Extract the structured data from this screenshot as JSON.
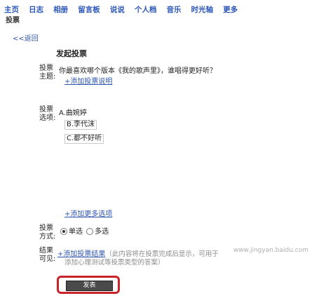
{
  "nav": {
    "items": [
      "主页",
      "日志",
      "相册",
      "留言板",
      "说说",
      "个人档",
      "音乐",
      "时光轴",
      "更多"
    ]
  },
  "subnav": {
    "label": "投票"
  },
  "back": {
    "label": "<<返回"
  },
  "form": {
    "heading": "发起投票",
    "subject_label": "投票主题:",
    "subject_value": "你最喜欢哪个版本《我的歌声里》，谁唱得更好听？",
    "add_desc_link": "+添加投票说明",
    "options_label": "投票选项:",
    "options": [
      "A.曲婉婷",
      "B.李代沫",
      "C.都不好听"
    ],
    "more_options_link": "+添加更多选项",
    "mode_label": "投票方式:",
    "mode_single": "单选",
    "mode_multi": "多选",
    "result_label": "结果可见:",
    "result_link": "+添加投票结果",
    "result_hint_1": "（此内容将在投票完成后显示，可用于",
    "result_hint_2": "添加心理测试等投票类型的答案）",
    "submit_label": "发表"
  },
  "watermark": "www.jingyan.baidu.com"
}
